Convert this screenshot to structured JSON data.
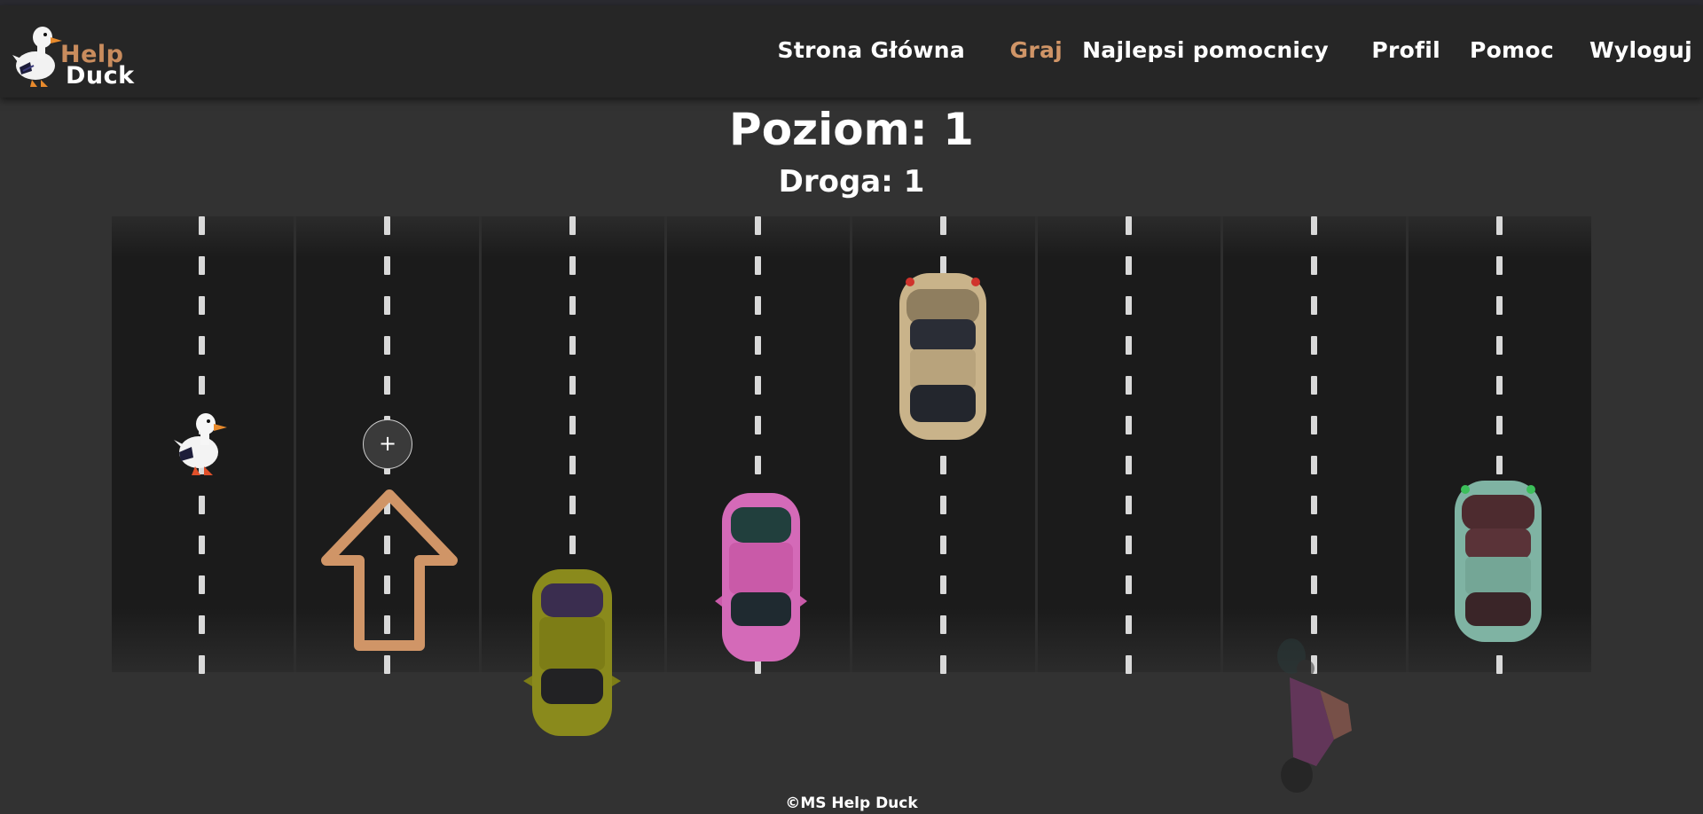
{
  "logo": {
    "line1": "Help",
    "line2": "Duck"
  },
  "nav": [
    {
      "label": "Strona Główna"
    },
    {
      "label": "Graj",
      "active": true
    },
    {
      "label": "Najlepsi pomocnicy"
    },
    {
      "label": "Profil"
    },
    {
      "label": "Pomoc"
    },
    {
      "label": "Wyloguj"
    }
  ],
  "game": {
    "level_label": "Poziom: 1",
    "road_label": "Droga: 1",
    "add_button": "+",
    "lanes": 8
  },
  "colors": {
    "accent": "#d09567",
    "car_beige": "#c9b38a",
    "car_pink": "#d46ab8",
    "car_olive": "#8a8a1c",
    "car_mint": "#7fb3a3",
    "motorbike": "#8a3a7a"
  },
  "icons": {
    "duck": "duck-icon",
    "arrow": "up-arrow-icon",
    "plus": "plus-icon"
  },
  "footer": {
    "text": "©MS Help Duck"
  }
}
